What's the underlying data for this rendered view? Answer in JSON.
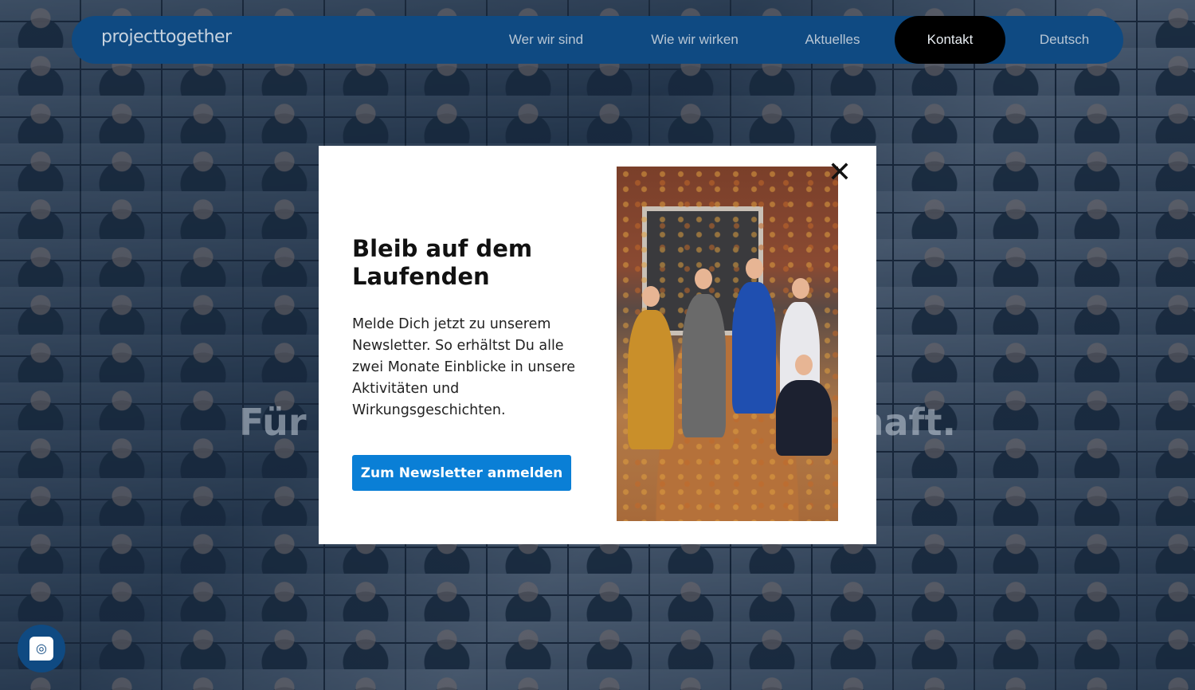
{
  "nav": {
    "logo": "projecttogether",
    "items": [
      {
        "label": "Wer wir sind"
      },
      {
        "label": "Wie wir wirken"
      },
      {
        "label": "Aktuelles"
      },
      {
        "label": "Kontakt",
        "active": true
      },
      {
        "label": "Deutsch"
      }
    ]
  },
  "hero": {
    "text_left": "Für",
    "text_right": "haft."
  },
  "modal": {
    "title": "Bleib auf dem Laufenden",
    "body": "Melde Dich jetzt zu unserem Newsletter. So erhältst Du alle zwei Monate Einblicke in unsere Aktivitäten und Wirkungsgeschichten.",
    "cta_label": "Zum Newsletter anmelden",
    "close_icon": "close-icon",
    "image": "team-photo-autumn-leaves"
  },
  "chat": {
    "icon": "fingerprint-chat-icon"
  },
  "colors": {
    "nav_bg": "#0f4a82",
    "active_bg": "#000000",
    "cta_bg": "#0a7fd6"
  }
}
